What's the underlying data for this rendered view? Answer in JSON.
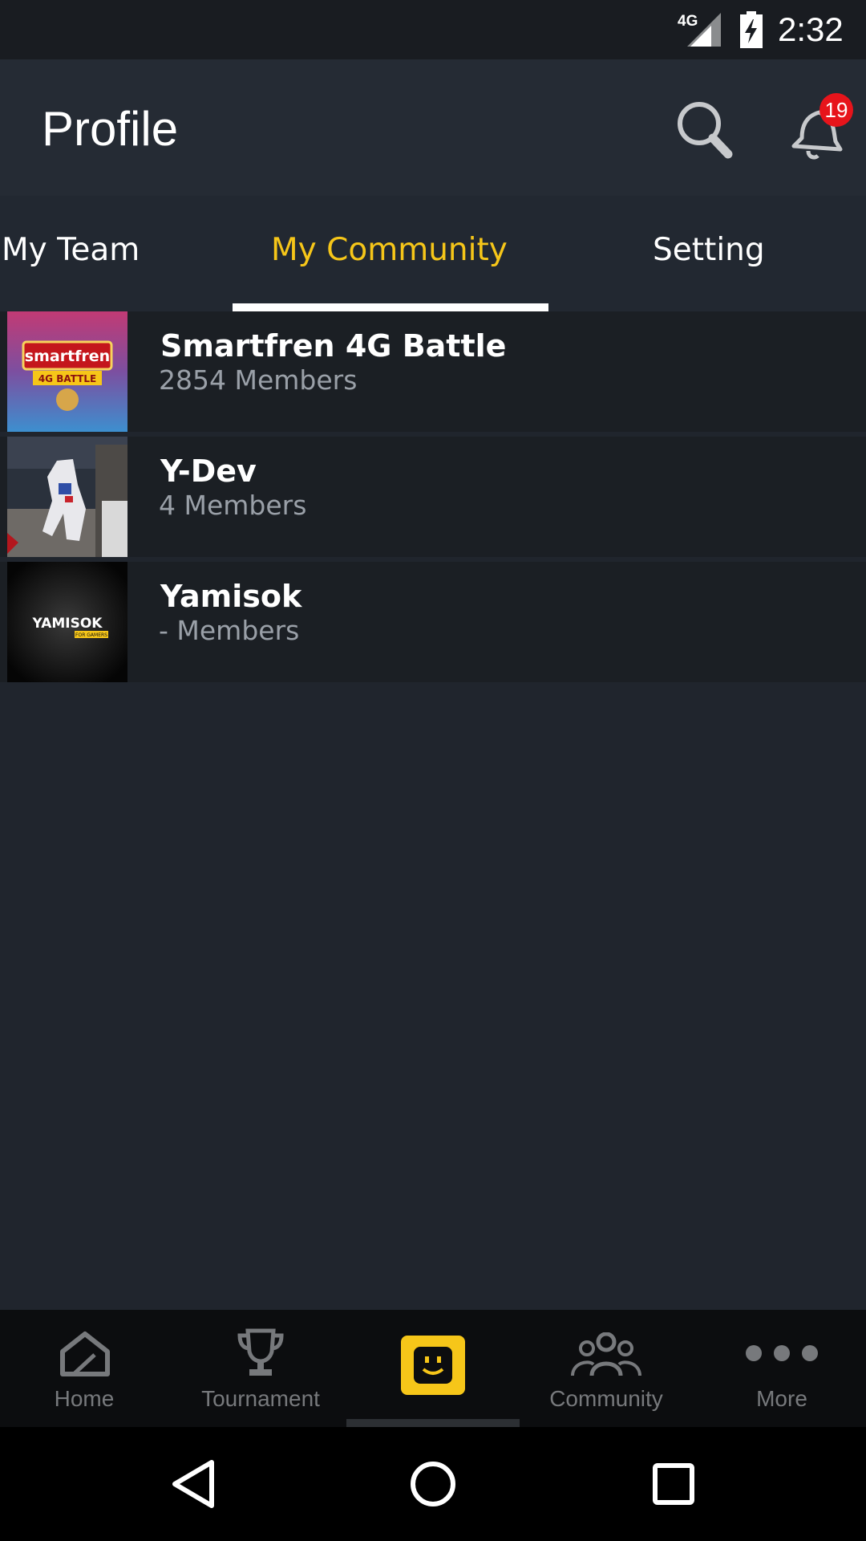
{
  "status_bar": {
    "network": "4G",
    "time": "2:32",
    "signal_icon": "signal-icon",
    "battery_icon": "battery-charging-icon"
  },
  "app_bar": {
    "title": "Profile",
    "search_icon": "search-icon",
    "notification_icon": "bell-icon",
    "notification_count": "19"
  },
  "tabs": [
    {
      "label": "My Team"
    },
    {
      "label": "My Community",
      "active": true
    },
    {
      "label": "Setting"
    }
  ],
  "communities": [
    {
      "name": "Smartfren 4G Battle",
      "members": "2854 Members",
      "thumb_text": "smartfren",
      "thumb_sub": "4G BATTLE"
    },
    {
      "name": "Y-Dev",
      "members": "4 Members"
    },
    {
      "name": "Yamisok",
      "members": "- Members",
      "thumb_text": "YAMISOK",
      "thumb_sub": "FOR GAMERS"
    }
  ],
  "bottom_nav": [
    {
      "label": "Home",
      "icon": "home-icon"
    },
    {
      "label": "Tournament",
      "icon": "trophy-icon"
    },
    {
      "label": "",
      "icon": "smiley-icon",
      "active": true
    },
    {
      "label": "Community",
      "icon": "people-icon"
    },
    {
      "label": "More",
      "icon": "more-dots-icon"
    }
  ],
  "colors": {
    "accent": "#f6c619",
    "badge": "#e7141b",
    "background": "#20252d",
    "row": "#1b1f24"
  }
}
